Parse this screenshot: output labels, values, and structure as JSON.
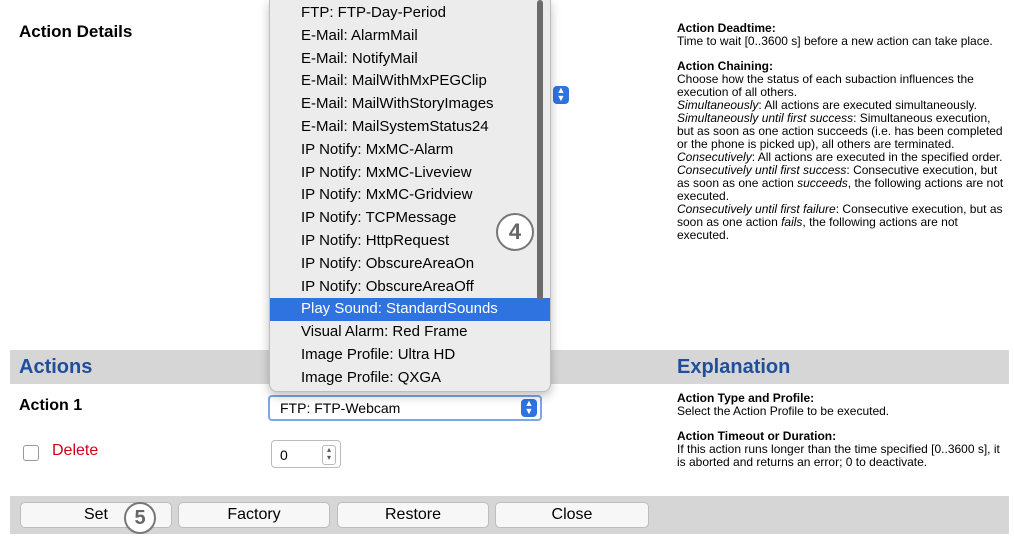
{
  "action_details_title": "Action Details",
  "actions_title": "Actions",
  "explanation_title": "Explanation",
  "action1_label": "Action 1",
  "delete_label": "Delete",
  "action_select_value": "FTP: FTP-Webcam",
  "timeout_value": "0",
  "dropdown_items": [
    "FTP: FTP-Day-Period",
    "E-Mail: AlarmMail",
    "E-Mail: NotifyMail",
    "E-Mail: MailWithMxPEGClip",
    "E-Mail: MailWithStoryImages",
    "E-Mail: MailSystemStatus24",
    "IP Notify: MxMC-Alarm",
    "IP Notify: MxMC-Liveview",
    "IP Notify: MxMC-Gridview",
    "IP Notify: TCPMessage",
    "IP Notify: HttpRequest",
    "IP Notify: ObscureAreaOn",
    "IP Notify: ObscureAreaOff",
    "Play Sound: StandardSounds",
    "Visual Alarm: Red Frame",
    "Image Profile: Ultra HD",
    "Image Profile: QXGA"
  ],
  "dropdown_selected": "Play Sound: StandardSounds",
  "callouts": {
    "four": "4",
    "five": "5"
  },
  "explanation_top": {
    "deadtime_title": "Action Deadtime",
    "deadtime_text": "Time to wait [0..3600 s] before a new action can take place.",
    "chaining_title": "Action Chaining",
    "chaining_intro": "Choose how the status of each subaction influences the execution of all others.",
    "sim_term": "Simultaneously",
    "sim_text": ": All actions are executed simultaneously.",
    "simsucc_term": "Simultaneously until first success",
    "simsucc_text": ": Simultaneous execution, but as soon as one action succeeds (i.e. has been completed or the phone is picked up), all others are terminated.",
    "cons_term": "Consecutively",
    "cons_text": ": All actions are executed in the specified order.",
    "conssucc_term": "Consecutively until first success",
    "conssucc_text1": ": Consecutive execution, but as soon as one action ",
    "conssucc_em": "succeeds",
    "conssucc_text2": ", the following actions are not executed.",
    "consfail_term": "Consecutively until first failure",
    "consfail_text1": ": Consecutive execution, but as soon as one action ",
    "consfail_em": "fails",
    "consfail_text2": ", the following actions are not executed."
  },
  "explanation_bottom": {
    "type_title": "Action Type and Profile",
    "type_text": "Select the Action Profile to be executed.",
    "timeout_title": "Action Timeout or Duration",
    "timeout_text": "If this action runs longer than the time specified [0..3600 s], it is aborted and returns an error; 0 to deactivate."
  },
  "buttons": {
    "set": "Set",
    "factory": "Factory",
    "restore": "Restore",
    "close": "Close"
  },
  "colors": {
    "accent_blue": "#1f4e9c",
    "delete_red": "#d0021b",
    "selection_blue": "#2f73e0",
    "band_gray": "#d6d6d6"
  }
}
